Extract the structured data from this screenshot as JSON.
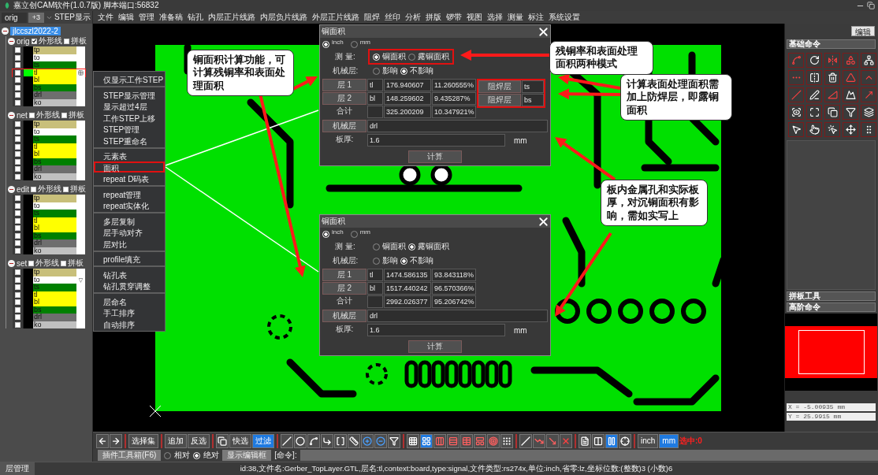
{
  "window": {
    "title": "嘉立创CAM软件(1.0.7版) 脚本端口:56832"
  },
  "left_panel": {
    "step_select": "orig",
    "expand_button": "+3",
    "step_label": "STEP显示",
    "job": {
      "name": "jlccszl2022-2",
      "selected": true,
      "expanded": true,
      "steps": [
        {
          "name": "orig",
          "expanded": true,
          "outline": {
            "label": "外形线",
            "checked": true
          },
          "panel": {
            "label": "拼板",
            "checked": false
          },
          "layers": [
            {
              "name": "tp",
              "color": "#c8bf7a",
              "checked": false,
              "selected": false
            },
            {
              "name": "to",
              "color": "#ffffff",
              "checked": false,
              "selected": false
            },
            {
              "name": "ts",
              "color": "#008000",
              "checked": false,
              "selected": false
            },
            {
              "name": "tl",
              "color": "#ffff00",
              "checked": false,
              "selected": true
            },
            {
              "name": "bl",
              "color": "#ffff00",
              "checked": false,
              "selected": false
            },
            {
              "name": "bs",
              "color": "#008000",
              "checked": false,
              "selected": false
            },
            {
              "name": "drl",
              "color": "#6e6e6e",
              "checked": false,
              "selected": false
            },
            {
              "name": "ko",
              "color": "#c0c0c0",
              "checked": false,
              "selected": false
            }
          ]
        },
        {
          "name": "net",
          "expanded": true,
          "outline": {
            "label": "外形线",
            "checked": false
          },
          "panel": {
            "label": "拼板",
            "checked": false
          },
          "layers": [
            {
              "name": "tp",
              "color": "#c8bf7a",
              "checked": false,
              "selected": false
            },
            {
              "name": "to",
              "color": "#ffffff",
              "checked": false,
              "selected": false
            },
            {
              "name": "ts",
              "color": "#008000",
              "checked": false,
              "selected": false
            },
            {
              "name": "tl",
              "color": "#ffff00",
              "checked": false,
              "selected": false
            },
            {
              "name": "bl",
              "color": "#ffff00",
              "checked": false,
              "selected": false
            },
            {
              "name": "bs",
              "color": "#008000",
              "checked": false,
              "selected": false
            },
            {
              "name": "drl",
              "color": "#6e6e6e",
              "checked": false,
              "selected": false
            },
            {
              "name": "ko",
              "color": "#c0c0c0",
              "checked": false,
              "selected": false
            }
          ]
        },
        {
          "name": "edit",
          "expanded": true,
          "outline": {
            "label": "外形线",
            "checked": false
          },
          "panel": {
            "label": "拼板",
            "checked": false
          },
          "layers": [
            {
              "name": "tp",
              "color": "#c8bf7a",
              "checked": false,
              "selected": false
            },
            {
              "name": "to",
              "color": "#ffffff",
              "checked": false,
              "selected": false
            },
            {
              "name": "ts",
              "color": "#008000",
              "checked": false,
              "selected": false
            },
            {
              "name": "tl",
              "color": "#ffff00",
              "checked": false,
              "selected": false
            },
            {
              "name": "bl",
              "color": "#ffff00",
              "checked": false,
              "selected": false
            },
            {
              "name": "bs",
              "color": "#008000",
              "checked": false,
              "selected": false
            },
            {
              "name": "drl",
              "color": "#6e6e6e",
              "checked": false,
              "selected": false
            },
            {
              "name": "ko",
              "color": "#c0c0c0",
              "checked": false,
              "selected": false
            }
          ]
        },
        {
          "name": "set",
          "expanded": true,
          "outline": {
            "label": "外形线",
            "checked": false
          },
          "panel": {
            "label": "拼板",
            "checked": false
          },
          "layers": [
            {
              "name": "tp",
              "color": "#c8bf7a",
              "checked": false,
              "selected": false
            },
            {
              "name": "to",
              "color": "#ffffff",
              "checked": false,
              "selected": false,
              "flag": "▽"
            },
            {
              "name": "ts",
              "color": "#008000",
              "checked": false,
              "selected": false
            },
            {
              "name": "tl",
              "color": "#ffff00",
              "checked": false,
              "selected": false
            },
            {
              "name": "bl",
              "color": "#ffff00",
              "checked": false,
              "selected": false
            },
            {
              "name": "bs",
              "color": "#008000",
              "checked": false,
              "selected": false
            },
            {
              "name": "drl",
              "color": "#6e6e6e",
              "checked": false,
              "selected": false
            },
            {
              "name": "ko",
              "color": "#c0c0c0",
              "checked": false,
              "selected": false
            }
          ]
        }
      ]
    }
  },
  "menu": [
    "文件",
    "编辑",
    "管理",
    "准备稿",
    "钻孔",
    "内层正片线路",
    "内层负片线路",
    "外层正片线路",
    "阻焊",
    "丝印",
    "分析",
    "拼版",
    "锣带",
    "视图",
    "选择",
    "测量",
    "标注",
    "系统设置"
  ],
  "dialogs": [
    {
      "title": "铜面积",
      "units": [
        {
          "label": "inch",
          "selected": true
        },
        {
          "label": "mm",
          "selected": false
        }
      ],
      "measure": {
        "label": "测 量:",
        "highlighted": true,
        "options": [
          {
            "label": "铜面积",
            "selected": true
          },
          {
            "label": "露铜面积",
            "selected": false
          }
        ]
      },
      "mechanical": {
        "label": "机械层:",
        "options": [
          {
            "label": "影响",
            "selected": false
          },
          {
            "label": "不影响",
            "selected": true
          }
        ]
      },
      "layers": [
        {
          "button": "层 1",
          "name": "tl",
          "area": "176.940607",
          "ratio": "11.260555%",
          "mask_button": "阻焊层",
          "mask": "ts"
        },
        {
          "button": "层 2",
          "name": "bl",
          "area": "148.259602",
          "ratio": "9.435287%",
          "mask_button": "阻焊层",
          "mask": "bs"
        }
      ],
      "mask_highlighted": true,
      "total": {
        "label": "合计",
        "area": "325.200209",
        "ratio": "10.347921%"
      },
      "mech_layer": {
        "button": "机械层",
        "value": "drl"
      },
      "thickness": {
        "label": "板厚:",
        "value": "1.6",
        "unit": "mm"
      },
      "compute_button": "计算"
    },
    {
      "title": "铜面积",
      "units": [
        {
          "label": "inch",
          "selected": true
        },
        {
          "label": "mm",
          "selected": false
        }
      ],
      "measure": {
        "label": "测 量:",
        "options": [
          {
            "label": "铜面积",
            "selected": false
          },
          {
            "label": "露铜面积",
            "selected": true
          }
        ]
      },
      "mechanical": {
        "label": "机械层:",
        "options": [
          {
            "label": "影响",
            "selected": false
          },
          {
            "label": "不影响",
            "selected": true
          }
        ]
      },
      "layers": [
        {
          "button": "层 1",
          "name": "tl",
          "area": "1474.586135",
          "ratio": "93.843118%"
        },
        {
          "button": "层 2",
          "name": "bl",
          "area": "1517.440242",
          "ratio": "96.570366%"
        }
      ],
      "total": {
        "label": "合计",
        "area": "2992.026377",
        "ratio": "95.206742%"
      },
      "mech_layer": {
        "button": "机械层",
        "value": "drl"
      },
      "thickness": {
        "label": "板厚:",
        "value": "1.6",
        "unit": "mm"
      },
      "compute_button": "计算"
    }
  ],
  "context_menu": [
    [
      {
        "label": "仅显示工作STEP",
        "selected": false
      }
    ],
    [
      {
        "label": "STEP显示管理",
        "selected": false
      },
      {
        "label": "显示超过4层",
        "selected": false
      },
      {
        "label": "工作STEP上移",
        "selected": false
      },
      {
        "label": "STEP管理",
        "selected": false
      },
      {
        "label": "STEP重命名",
        "selected": false
      }
    ],
    [
      {
        "label": "元素表",
        "selected": false
      },
      {
        "label": "面积",
        "selected": true
      },
      {
        "label": "repeat D码表",
        "selected": false
      }
    ],
    [
      {
        "label": "repeat管理",
        "selected": false
      },
      {
        "label": "repeat实体化",
        "selected": false
      }
    ],
    [
      {
        "label": "多层复制",
        "selected": false
      },
      {
        "label": "层手动对齐",
        "selected": false
      },
      {
        "label": "层对比",
        "selected": false
      }
    ],
    [
      {
        "label": "profile填充",
        "selected": false
      }
    ],
    [
      {
        "label": "钻孔表",
        "selected": false
      },
      {
        "label": "钻孔贯穿调整",
        "selected": false
      }
    ],
    [
      {
        "label": "层命名",
        "selected": false
      },
      {
        "label": "手工排序",
        "selected": false
      },
      {
        "label": "自动排序",
        "selected": false
      }
    ]
  ],
  "callouts": [
    "铜面积计算功能，可计算残铜率和表面处理面积",
    "残铜率和表面处理面积两种模式",
    "计算表面处理面积需加上防焊层，即露铜面积",
    "板内金属孔和实际板厚，对沉铜面积有影响，需如实写上"
  ],
  "right_panel": {
    "edit_button": "编辑",
    "basic_commands": "基础命令",
    "panel_tools": "拼板工具",
    "advanced_commands": "高阶命令",
    "coordinates": [
      "X = -5.00935 mm",
      "Y = 25.9915 mm"
    ]
  },
  "toolbar": [
    [
      {
        "kind": "icon",
        "selected": false
      },
      {
        "kind": "icon",
        "selected": false
      }
    ],
    [
      {
        "kind": "text",
        "label": "选择集",
        "selected": false
      }
    ],
    [
      {
        "kind": "text",
        "label": "追加",
        "selected": false
      },
      {
        "kind": "text",
        "label": "反选",
        "selected": false
      }
    ],
    [
      {
        "kind": "icon",
        "selected": false
      },
      {
        "kind": "text",
        "label": "快选",
        "selected": false
      },
      {
        "kind": "text",
        "label": "过滤",
        "selected": true
      }
    ],
    [
      {
        "kind": "icon",
        "selected": false
      },
      {
        "kind": "icon",
        "selected": false
      },
      {
        "kind": "icon",
        "selected": false
      },
      {
        "kind": "icon",
        "selected": false
      },
      {
        "kind": "icon",
        "selected": false
      },
      {
        "kind": "icon",
        "selected": false
      },
      {
        "kind": "icon",
        "selected": false
      },
      {
        "kind": "icon",
        "selected": false
      },
      {
        "kind": "icon",
        "selected": false
      }
    ],
    [
      {
        "kind": "icon",
        "selected": false
      },
      {
        "kind": "icon",
        "selected": true
      },
      {
        "kind": "icon",
        "selected": false
      },
      {
        "kind": "icon",
        "selected": false
      },
      {
        "kind": "icon",
        "selected": false
      },
      {
        "kind": "icon",
        "selected": false
      },
      {
        "kind": "icon",
        "selected": false
      },
      {
        "kind": "icon",
        "selected": false
      }
    ],
    [
      {
        "kind": "icon",
        "selected": false
      },
      {
        "kind": "icon",
        "selected": false
      },
      {
        "kind": "icon",
        "selected": false
      },
      {
        "kind": "icon",
        "selected": false
      }
    ],
    [
      {
        "kind": "icon",
        "selected": false
      },
      {
        "kind": "icon",
        "selected": false
      },
      {
        "kind": "icon",
        "selected": true
      },
      {
        "kind": "icon",
        "selected": false
      }
    ],
    [
      {
        "kind": "text",
        "label": "inch",
        "selected": false
      },
      {
        "kind": "text",
        "label": "mm",
        "selected": true
      },
      {
        "kind": "readout",
        "label": "选中:0"
      }
    ]
  ],
  "command_row": {
    "plugin_button": "插件工具箱(F6)",
    "modes": [
      {
        "label": "相对",
        "selected": false
      },
      {
        "label": "绝对",
        "selected": true
      }
    ],
    "editor_button": "显示编辑框",
    "command_label": "[命令]:"
  },
  "status_bar": {
    "tab": "层管理",
    "text": "id:38,文件名:Gerber_TopLayer.GTL,层名:tl,context:board,type:signal,文件类型:rs274x,单位:inch,省零:lz,坐标位数:(整数)3 (小数)6"
  }
}
